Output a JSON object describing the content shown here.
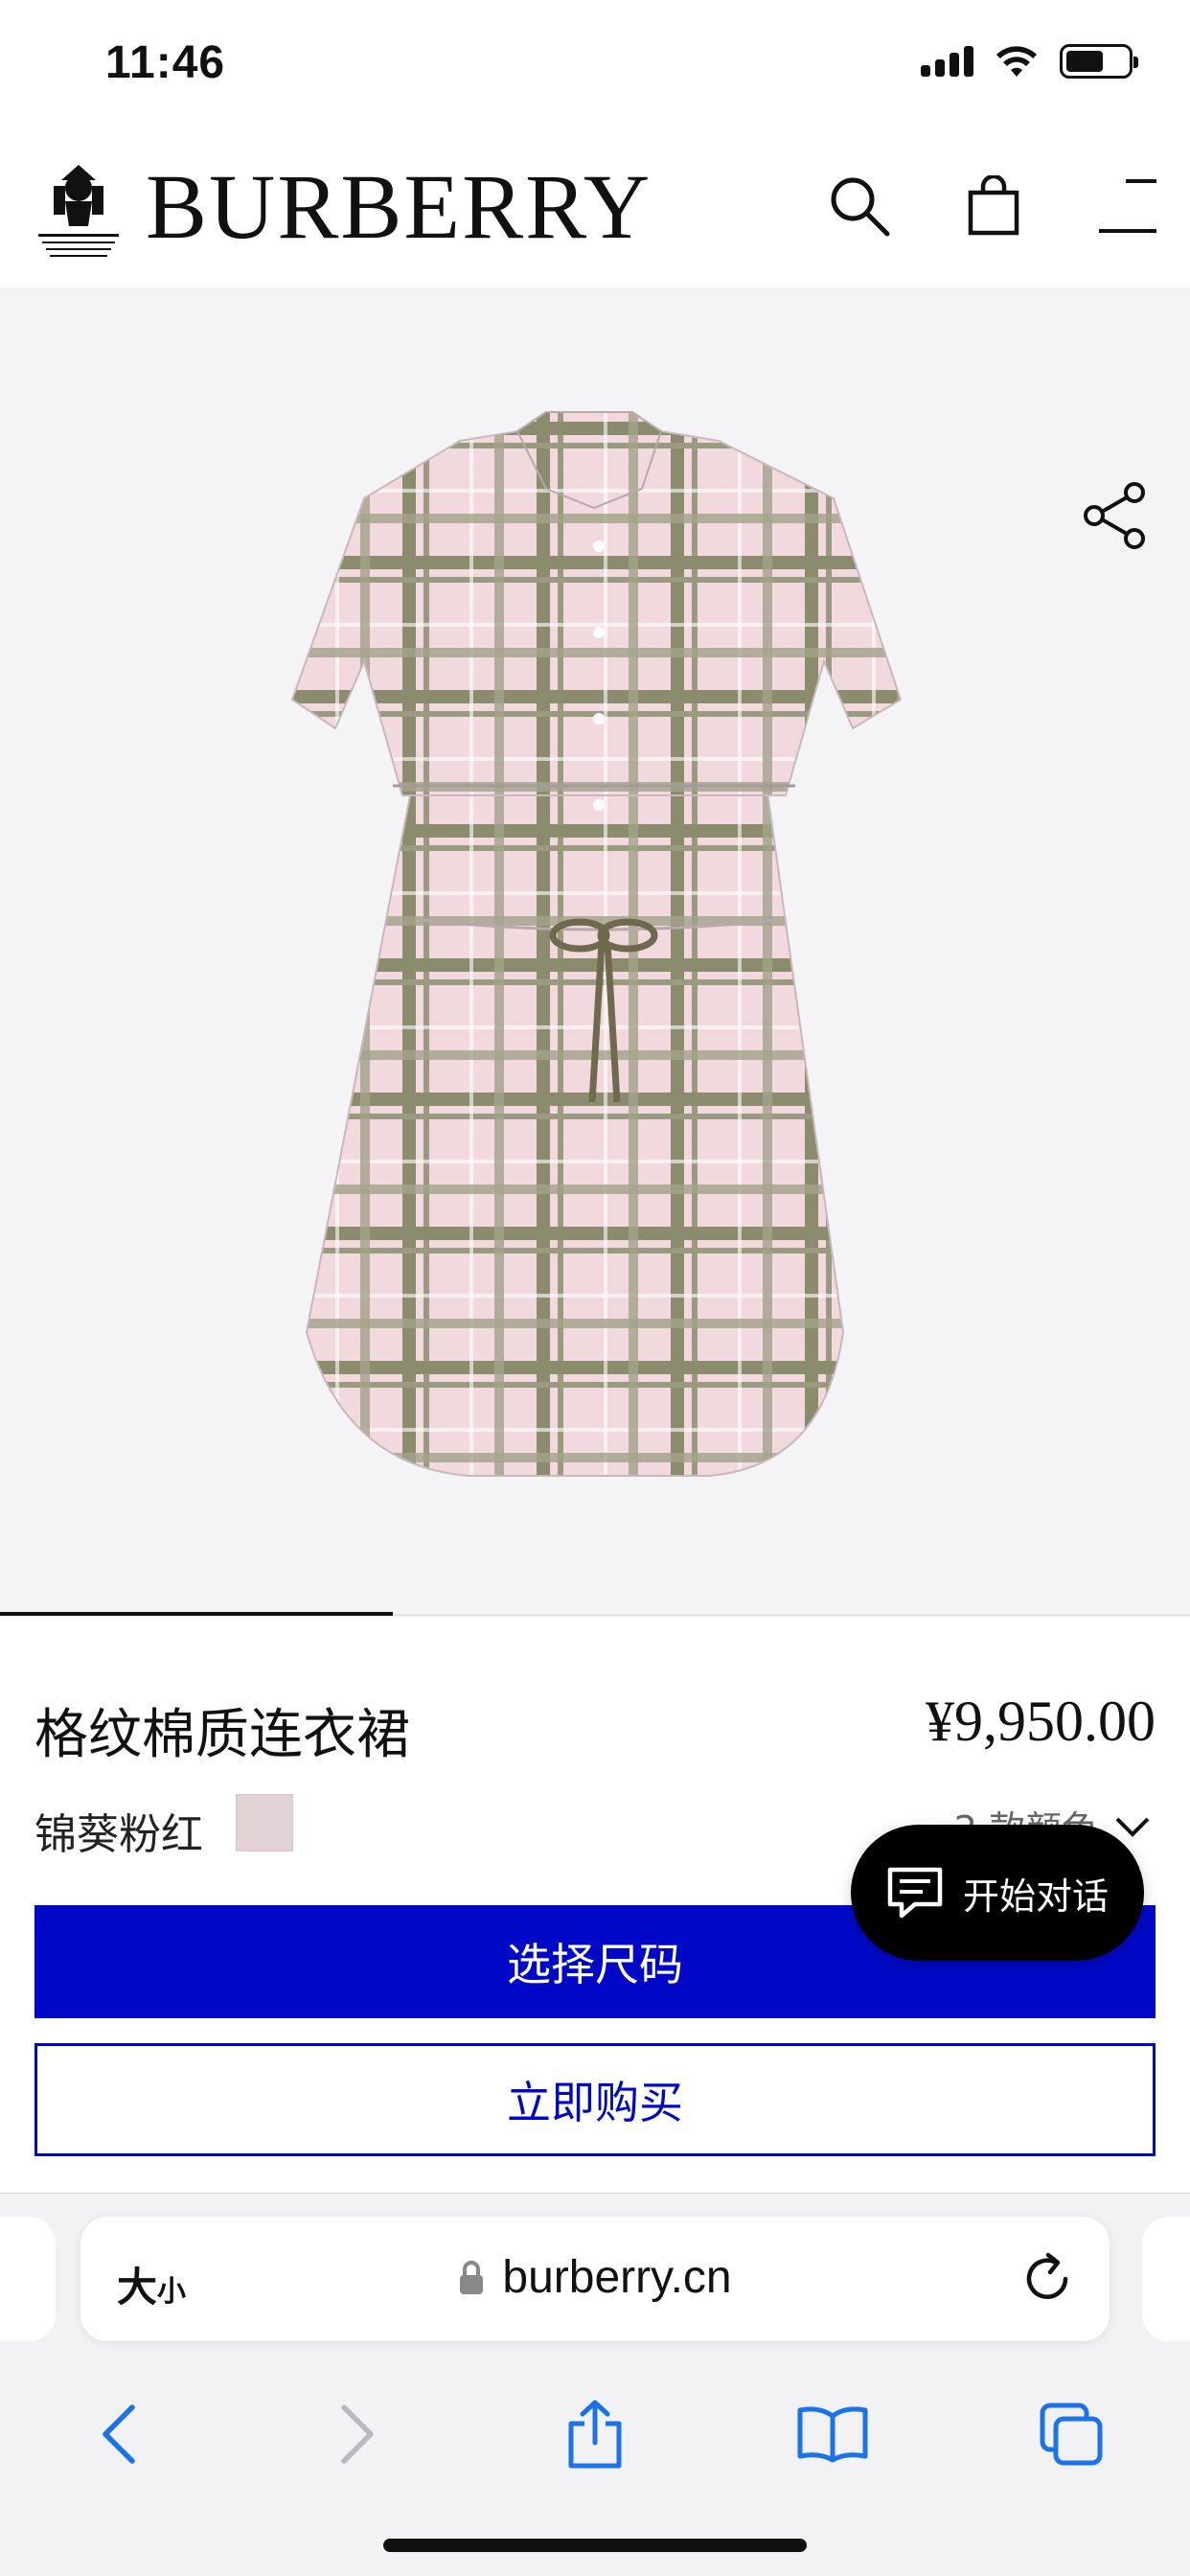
{
  "status_bar": {
    "time": "11:46"
  },
  "header": {
    "brand": "BURBERRY"
  },
  "product": {
    "name": "格纹棉质连衣裙",
    "price": "¥9,950.00",
    "color_name": "锦葵粉红",
    "color_swatch": "#e3d2d6",
    "color_count": "2 款颜色",
    "select_size_label": "选择尺码",
    "buy_now_label": "立即购买"
  },
  "chat": {
    "label": "开始对话"
  },
  "browser": {
    "text_size_big": "大",
    "text_size_small": "小",
    "domain": "burberry.cn"
  },
  "colors": {
    "accent_blue": "#0008c8",
    "chat_bg": "#000000"
  }
}
